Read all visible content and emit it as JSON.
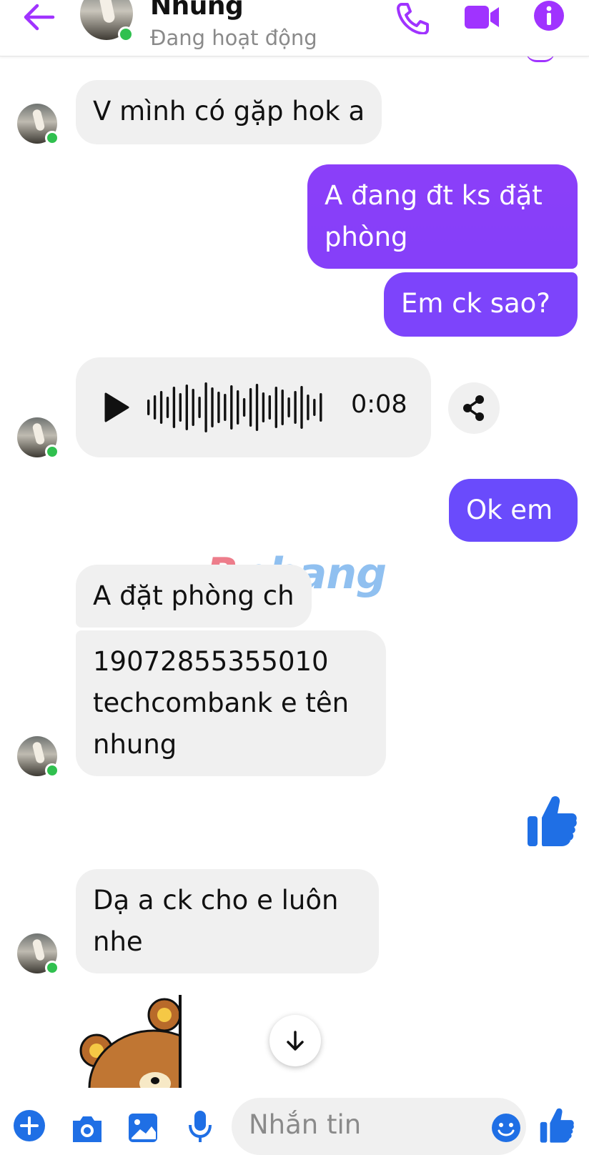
{
  "header": {
    "contact_name": "Nhung",
    "status": "Đang hoạt động"
  },
  "messages": {
    "m1": "V mình có gặp hok a",
    "m2_line1": "A đang đt ks đặt",
    "m2_line2": "phòng",
    "m3": "Em ck sao?",
    "audio_duration": "0:08",
    "m4": "Ok em",
    "m5": "A đặt phòng ch",
    "m6_line1": "19072855355010",
    "m6_line2": "techcombank e tên",
    "m6_line3": "nhung",
    "m7_line1": "Dạ a ck cho e luôn",
    "m7_line2": "nhe"
  },
  "watermark": {
    "first": "R",
    "rest": "phang"
  },
  "composer": {
    "placeholder": "Nhắn tin"
  },
  "colors": {
    "accent": "#a033ff",
    "outgoing_bubble_top": "#8b3ff9",
    "outgoing_bubble_bottom": "#6f47ff",
    "like_blue": "#1f6fe5",
    "incoming_bubble": "#f0f0f0",
    "online": "#30c04f"
  },
  "icons": [
    "back-arrow-icon",
    "phone-icon",
    "video-camera-icon",
    "info-icon",
    "play-icon",
    "share-icon",
    "thumbs-up-icon",
    "plus-icon",
    "camera-icon",
    "image-icon",
    "microphone-icon",
    "emoji-icon",
    "scroll-down-arrow-icon"
  ]
}
